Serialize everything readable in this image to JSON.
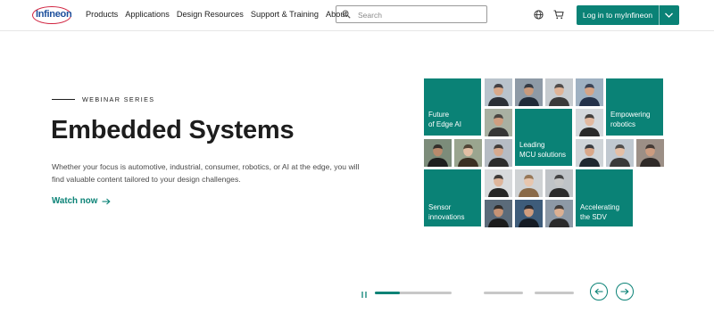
{
  "brand": {
    "logo_text": "Infineon"
  },
  "nav": {
    "items": [
      "Products",
      "Applications",
      "Design Resources",
      "Support & Training",
      "About"
    ]
  },
  "search": {
    "placeholder": "Search"
  },
  "header_actions": {
    "login_label": "Log in to myInfineon"
  },
  "hero": {
    "eyebrow": "WEBINAR SERIES",
    "title": "Embedded Systems",
    "description": "Whether your focus is automotive, industrial, consumer, robotics, or AI at the edge, you will find valuable content tailored to your design challenges.",
    "cta_label": "Watch now"
  },
  "mosaic": {
    "tiles": [
      {
        "line1": "Future",
        "line2": "of Edge AI"
      },
      {
        "line1": "Empowering",
        "line2": "robotics"
      },
      {
        "line1": "Leading",
        "line2": "MCU solutions"
      },
      {
        "line1": "Sensor",
        "line2": "innovations"
      },
      {
        "line1": "Accelerating",
        "line2": "the SDV"
      }
    ]
  },
  "carousel": {
    "slide_count": 4,
    "active_index": 0,
    "active_progress": 0.32
  },
  "colors": {
    "accent": "#0a8276",
    "logo_red": "#d01f3c",
    "logo_blue": "#1c4f9c"
  },
  "icons": [
    "search-icon",
    "globe-icon",
    "cart-icon",
    "chevron-down-icon",
    "arrow-right-icon",
    "pause-icon",
    "arrow-left-icon"
  ]
}
